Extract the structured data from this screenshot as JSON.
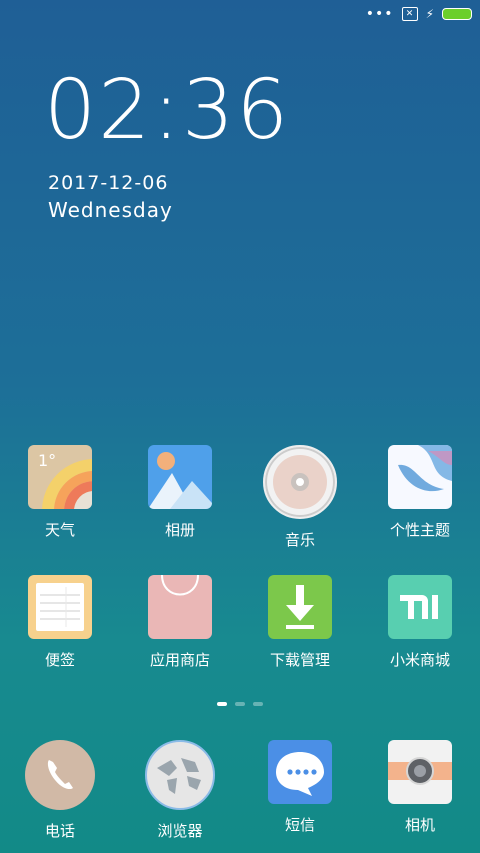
{
  "status": {
    "more": "•••",
    "sim": "✕"
  },
  "lock": {
    "time": "02:36",
    "date": "2017-12-06",
    "weekday": "Wednesday"
  },
  "weather": {
    "degree": "1°"
  },
  "apps_row1": [
    {
      "label": "天气"
    },
    {
      "label": "相册"
    },
    {
      "label": "音乐"
    },
    {
      "label": "个性主题"
    }
  ],
  "apps_row2": [
    {
      "label": "便签"
    },
    {
      "label": "应用商店"
    },
    {
      "label": "下载管理"
    },
    {
      "label": "小米商城"
    }
  ],
  "dock": [
    {
      "label": "电话"
    },
    {
      "label": "浏览器"
    },
    {
      "label": "短信"
    },
    {
      "label": "相机"
    }
  ],
  "pages": {
    "count": 3,
    "current": 1
  },
  "colors": {
    "battery": "#6ccf2b",
    "accent": "#4fa0ea"
  }
}
